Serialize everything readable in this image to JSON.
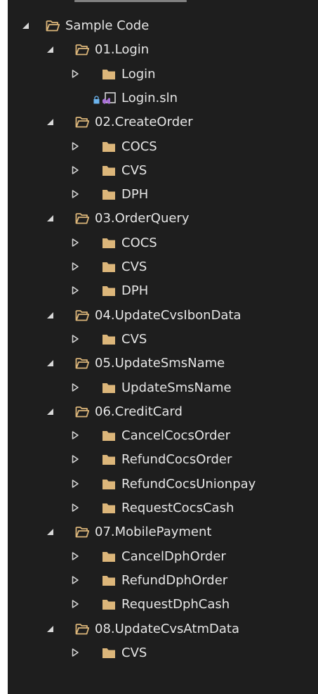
{
  "colors": {
    "background": "#1e1e1e",
    "text": "#e6e6e6",
    "expander": "#d8d8d8",
    "folder": "#dcb67a",
    "solution_purple": "#a971d6",
    "lock_blue": "#6cb4ee"
  },
  "tree": [
    {
      "label": "Sample Code",
      "level": 0,
      "type": "folder-open",
      "expander": "expanded"
    },
    {
      "label": "01.Login",
      "level": 1,
      "type": "folder-open",
      "expander": "expanded"
    },
    {
      "label": "Login",
      "level": 2,
      "type": "folder",
      "expander": "collapsed"
    },
    {
      "label": "Login.sln",
      "level": 2,
      "type": "solution",
      "expander": "none",
      "locked": true
    },
    {
      "label": "02.CreateOrder",
      "level": 1,
      "type": "folder-open",
      "expander": "expanded"
    },
    {
      "label": "COCS",
      "level": 2,
      "type": "folder",
      "expander": "collapsed"
    },
    {
      "label": "CVS",
      "level": 2,
      "type": "folder",
      "expander": "collapsed"
    },
    {
      "label": "DPH",
      "level": 2,
      "type": "folder",
      "expander": "collapsed"
    },
    {
      "label": "03.OrderQuery",
      "level": 1,
      "type": "folder-open",
      "expander": "expanded"
    },
    {
      "label": "COCS",
      "level": 2,
      "type": "folder",
      "expander": "collapsed"
    },
    {
      "label": "CVS",
      "level": 2,
      "type": "folder",
      "expander": "collapsed"
    },
    {
      "label": "DPH",
      "level": 2,
      "type": "folder",
      "expander": "collapsed"
    },
    {
      "label": "04.UpdateCvsIbonData",
      "level": 1,
      "type": "folder-open",
      "expander": "expanded"
    },
    {
      "label": "CVS",
      "level": 2,
      "type": "folder",
      "expander": "collapsed"
    },
    {
      "label": "05.UpdateSmsName",
      "level": 1,
      "type": "folder-open",
      "expander": "expanded"
    },
    {
      "label": "UpdateSmsName",
      "level": 2,
      "type": "folder",
      "expander": "collapsed"
    },
    {
      "label": "06.CreditCard",
      "level": 1,
      "type": "folder-open",
      "expander": "expanded"
    },
    {
      "label": "CancelCocsOrder",
      "level": 2,
      "type": "folder",
      "expander": "collapsed"
    },
    {
      "label": "RefundCocsOrder",
      "level": 2,
      "type": "folder",
      "expander": "collapsed"
    },
    {
      "label": "RefundCocsUnionpay",
      "level": 2,
      "type": "folder",
      "expander": "collapsed"
    },
    {
      "label": "RequestCocsCash",
      "level": 2,
      "type": "folder",
      "expander": "collapsed"
    },
    {
      "label": "07.MobilePayment",
      "level": 1,
      "type": "folder-open",
      "expander": "expanded"
    },
    {
      "label": "CancelDphOrder",
      "level": 2,
      "type": "folder",
      "expander": "collapsed"
    },
    {
      "label": "RefundDphOrder",
      "level": 2,
      "type": "folder",
      "expander": "collapsed"
    },
    {
      "label": "RequestDphCash",
      "level": 2,
      "type": "folder",
      "expander": "collapsed"
    },
    {
      "label": "08.UpdateCvsAtmData",
      "level": 1,
      "type": "folder-open",
      "expander": "expanded"
    },
    {
      "label": "CVS",
      "level": 2,
      "type": "folder",
      "expander": "collapsed"
    }
  ]
}
